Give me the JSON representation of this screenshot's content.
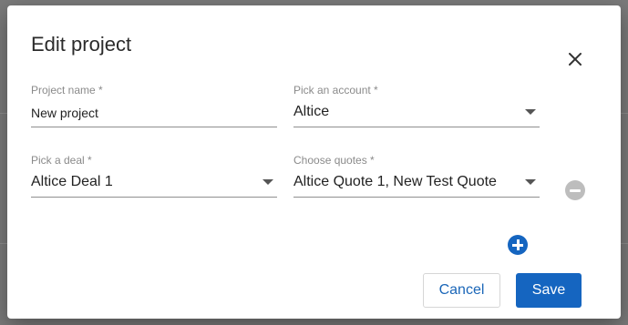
{
  "dialog": {
    "title": "Edit project",
    "close_icon": "close-icon"
  },
  "fields": {
    "project_name": {
      "label": "Project name *",
      "value": "New project"
    },
    "account": {
      "label": "Pick an account *",
      "value": "Altice"
    },
    "deal": {
      "label": "Pick a deal *",
      "value": "Altice Deal 1"
    },
    "quotes": {
      "label": "Choose quotes *",
      "value": "Altice Quote 1, New Test Quote"
    }
  },
  "row_actions": {
    "remove_icon": "minus-circle-icon",
    "add_icon": "plus-circle-icon"
  },
  "footer": {
    "cancel_label": "Cancel",
    "save_label": "Save"
  },
  "colors": {
    "primary": "#1565c0",
    "overlay": "#7a7a7a",
    "disabled_icon": "#bdbdbd"
  }
}
